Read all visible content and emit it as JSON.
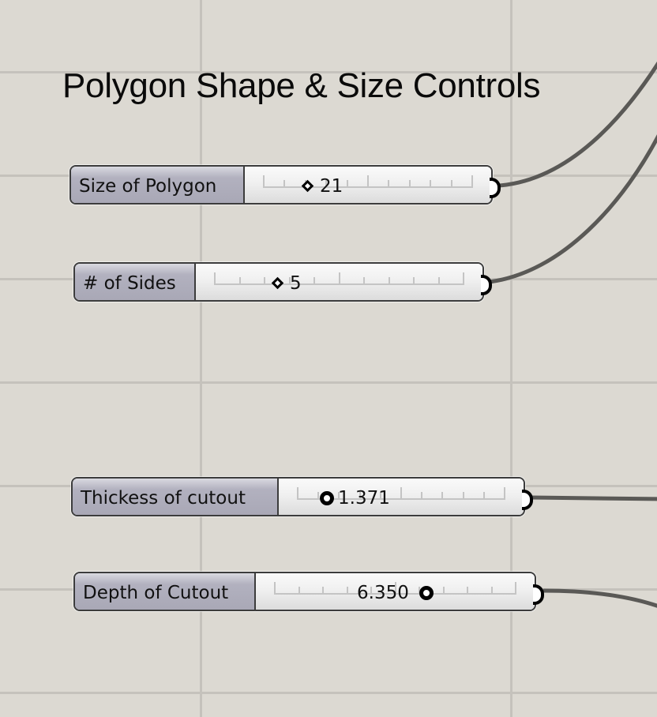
{
  "canvas": {
    "background": "#dcd9d2",
    "grid_color": "#c5c2bc",
    "wire_color": "#5a5956"
  },
  "group": {
    "title": "Polygon Shape & Size Controls"
  },
  "sliders": [
    {
      "label": "Size of Polygon",
      "value": "21",
      "knob": "diamond-icon",
      "knob_position": 0.24,
      "value_side": "right"
    },
    {
      "label": "# of Sides",
      "value": "5",
      "knob": "diamond-icon",
      "knob_position": 0.24,
      "value_side": "right"
    },
    {
      "label": "Thickess of cutout",
      "value": "1.371",
      "knob": "circle-icon",
      "knob_position": 0.14,
      "value_side": "right"
    },
    {
      "label": "Depth of Cutout",
      "value": "6.350",
      "knob": "circle-icon",
      "knob_position": 0.62,
      "value_side": "left"
    }
  ]
}
